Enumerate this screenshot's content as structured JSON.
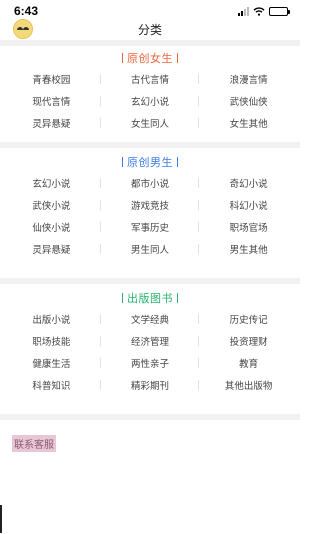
{
  "status_bar": {
    "time": "6:43"
  },
  "nav": {
    "title": "分类"
  },
  "sections": [
    {
      "title": "原创女生",
      "accent": "#f0643c",
      "items": [
        "青春校园",
        "古代言情",
        "浪漫言情",
        "现代言情",
        "玄幻小说",
        "武侠仙侠",
        "灵异悬疑",
        "女生同人",
        "女生其他"
      ]
    },
    {
      "title": "原创男生",
      "accent": "#3c7ee8",
      "items": [
        "玄幻小说",
        "都市小说",
        "奇幻小说",
        "武侠小说",
        "游戏竞技",
        "科幻小说",
        "仙侠小说",
        "军事历史",
        "职场官场",
        "灵异悬疑",
        "男生同人",
        "男生其他"
      ]
    },
    {
      "title": "出版图书",
      "accent": "#28b46e",
      "items": [
        "出版小说",
        "文学经典",
        "历史传记",
        "职场技能",
        "经济管理",
        "投资理财",
        "健康生活",
        "两性亲子",
        "教育",
        "科普知识",
        "精彩期刊",
        "其他出版物"
      ]
    }
  ],
  "footer": {
    "contact_label": "联系客服",
    "contact_bg": "#e9c6d6",
    "contact_color": "#8a5a74"
  }
}
